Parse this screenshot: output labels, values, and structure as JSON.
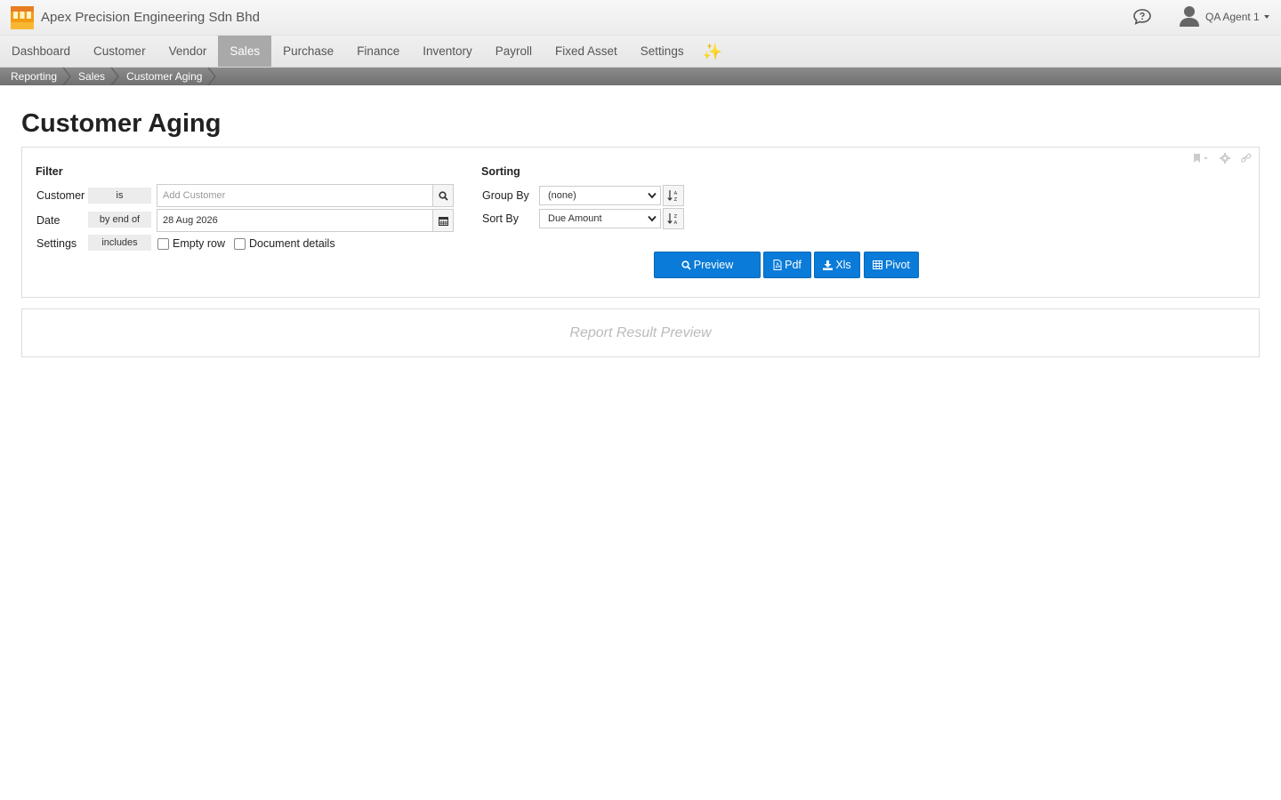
{
  "header": {
    "company": "Apex Precision Engineering Sdn Bhd",
    "user": "QA Agent 1"
  },
  "nav": {
    "items": [
      "Dashboard",
      "Customer",
      "Vendor",
      "Sales",
      "Purchase",
      "Finance",
      "Inventory",
      "Payroll",
      "Fixed Asset",
      "Settings"
    ],
    "active": "Sales",
    "extra_icon": "sparkles-icon"
  },
  "breadcrumb": [
    "Reporting",
    "Sales",
    "Customer Aging"
  ],
  "page": {
    "title": "Customer Aging"
  },
  "filter": {
    "title": "Filter",
    "rows": [
      {
        "label": "Customer",
        "operator": "is",
        "placeholder": "Add Customer",
        "value": ""
      },
      {
        "label": "Date",
        "operator": "by end of",
        "value": "28 Aug 2026"
      },
      {
        "label": "Settings",
        "operator": "includes"
      }
    ],
    "options": [
      "Empty row",
      "Document details"
    ]
  },
  "sorting": {
    "title": "Sorting",
    "group_by_label": "Group By",
    "group_by_value": "(none)",
    "sort_by_label": "Sort By",
    "sort_by_value": "Due Amount"
  },
  "actions": {
    "preview": "Preview",
    "pdf": "Pdf",
    "xls": "Xls",
    "pivot": "Pivot"
  },
  "result": {
    "placeholder": "Report Result Preview"
  },
  "colors": {
    "primary": "#0a7bd8",
    "nav_active": "#a9a9a9",
    "breadcrumb_bg": "#7d7d7d"
  }
}
